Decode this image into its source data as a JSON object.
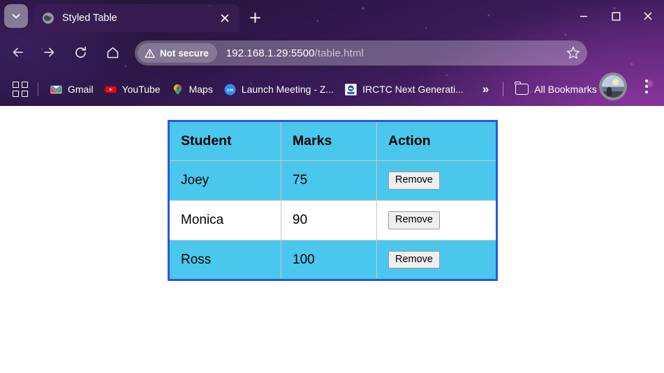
{
  "window": {
    "minimize_label": "Minimize",
    "maximize_label": "Maximize",
    "close_label": "Close"
  },
  "tabstrip": {
    "tab_search_label": "Search tabs",
    "tabs": [
      {
        "title": "Styled Table",
        "favicon": "globe-icon",
        "close_label": "Close tab"
      }
    ],
    "new_tab_label": "New tab"
  },
  "toolbar": {
    "back_label": "Back",
    "forward_label": "Forward",
    "reload_label": "Reload",
    "home_label": "Home",
    "security_badge": "Not secure",
    "url_host": "192.168.1.29:5500",
    "url_path": "/table.html",
    "url_full": "192.168.1.29:5500/table.html",
    "bookmark_star_label": "Bookmark this tab",
    "profile_label": "Profile",
    "menu_label": "Customize and control Google Chrome"
  },
  "bookmarks": {
    "apps_label": "Apps",
    "items": [
      {
        "label": "Gmail",
        "icon": "gmail-icon"
      },
      {
        "label": "YouTube",
        "icon": "youtube-icon"
      },
      {
        "label": "Maps",
        "icon": "maps-icon"
      },
      {
        "label": "Launch Meeting - Z...",
        "icon": "zoom-icon"
      },
      {
        "label": "IRCTC Next Generati...",
        "icon": "irctc-icon"
      }
    ],
    "overflow_label": "»",
    "all_bookmarks_label": "All Bookmarks"
  },
  "page": {
    "title": "Styled Table",
    "table": {
      "columns": [
        "Student",
        "Marks",
        "Action"
      ],
      "rows": [
        {
          "student": "Joey",
          "marks": "75",
          "action": "Remove",
          "striped": false
        },
        {
          "student": "Monica",
          "marks": "90",
          "action": "Remove",
          "striped": true
        },
        {
          "student": "Ross",
          "marks": "100",
          "action": "Remove",
          "striped": false
        }
      ],
      "colors": {
        "border": "#2b56e0",
        "cell_background": "#4ac7ec",
        "alt_row_background": "#ffffff",
        "cell_border": "#c8c8c8",
        "text": "#000000",
        "button_background": "#efefef"
      }
    }
  }
}
